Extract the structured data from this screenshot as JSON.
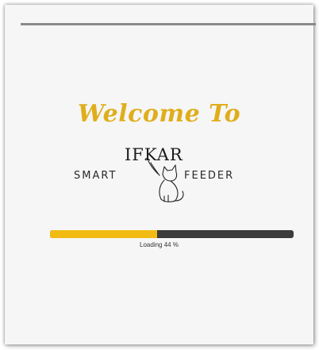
{
  "splash": {
    "welcome_text": "Welcome To",
    "brand_text": "IFKAR",
    "subtitle_left": "SMART",
    "subtitle_right": "FEEDER",
    "logo_icon": "cat-icon"
  },
  "progress": {
    "value_percent": 44,
    "label": "Loading 44 %"
  },
  "colors": {
    "accent": "#dfae1c",
    "progress_fill": "#f2bb14",
    "progress_track": "#3b3b3b",
    "background": "#f6f6f6",
    "status_bar": "#8a8a8a"
  }
}
